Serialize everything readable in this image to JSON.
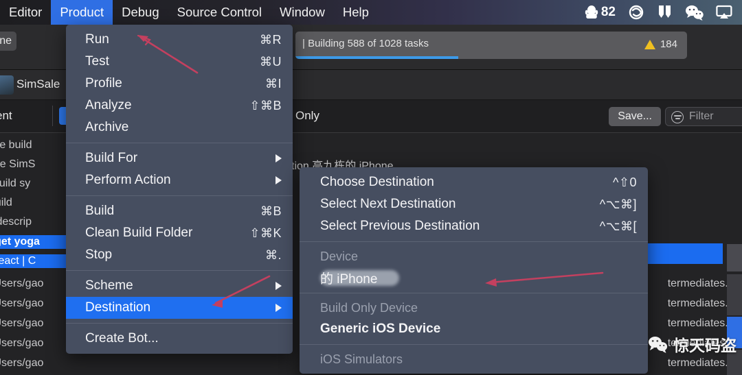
{
  "menubar": {
    "items": [
      {
        "label": "Editor",
        "active": false
      },
      {
        "label": "Product",
        "active": true
      },
      {
        "label": "Debug",
        "active": false
      },
      {
        "label": "Source Control",
        "active": false
      },
      {
        "label": "Window",
        "active": false
      },
      {
        "label": "Help",
        "active": false
      }
    ],
    "status_icons": [
      {
        "name": "qq-icon",
        "badge": "82"
      },
      {
        "name": "adobe-creative-cloud-icon"
      },
      {
        "name": "microsoft-office-icon"
      },
      {
        "name": "wechat-icon"
      },
      {
        "name": "airplay-icon"
      }
    ],
    "qq_count": "82"
  },
  "toolbar": {
    "scheme_pill": "one",
    "status_text": "| Building 588 of 1028 tasks",
    "warning_count": "184",
    "progress_percent": 41.5,
    "project_name": "SimSale",
    "left_label": "ent",
    "only_label": "Only",
    "save_label": "Save...",
    "filter_placeholder": "Filter"
  },
  "product_menu": {
    "groups": [
      [
        {
          "label": "Run",
          "key": "⌘R"
        },
        {
          "label": "Test",
          "key": "⌘U"
        },
        {
          "label": "Profile",
          "key": "⌘I"
        },
        {
          "label": "Analyze",
          "key": "⇧⌘B"
        },
        {
          "label": "Archive",
          "key": ""
        }
      ],
      [
        {
          "label": "Build For",
          "key": "",
          "submenu": true
        },
        {
          "label": "Perform Action",
          "key": "",
          "submenu": true
        }
      ],
      [
        {
          "label": "Build",
          "key": "⌘B"
        },
        {
          "label": "Clean Build Folder",
          "key": "⇧⌘K"
        },
        {
          "label": "Stop",
          "key": "⌘."
        }
      ],
      [
        {
          "label": "Scheme",
          "key": "",
          "submenu": true
        },
        {
          "label": "Destination",
          "key": "",
          "submenu": true,
          "selected": true
        }
      ],
      [
        {
          "label": "Create Bot...",
          "key": ""
        }
      ]
    ]
  },
  "destination_menu": {
    "items": [
      {
        "label": "Choose Destination",
        "key": "^⇧0"
      },
      {
        "label": "Select Next Destination",
        "key": "^⌥⌘]"
      },
      {
        "label": "Select Previous Destination",
        "key": "^⌥⌘["
      }
    ],
    "device_section": "Device",
    "device_name_suffix": "的 iPhone",
    "build_only_section": "Build Only Device",
    "generic_device": "Generic iOS Device",
    "simulators_section": "iOS Simulators"
  },
  "log": {
    "behind_menu_line": "tion 高九栋的 iPhone",
    "left_lines": [
      "re build",
      "pace SimS",
      "w build sy",
      "build",
      "ild descrip"
    ],
    "selected_lines": [
      "arget yoga",
      "t React | C"
    ],
    "path_lines": [
      "/Users/gao",
      "/Users/gao",
      "/Users/gao",
      "/Users/gao",
      "/Users/gao"
    ],
    "right_lines": [
      "termediates.noin",
      "termediates.noin",
      "termediates.noin",
      "termediates.noin",
      "termediates.noin"
    ]
  },
  "annotations": {
    "arrow_color": "#c4405f",
    "arrows": [
      {
        "name": "arrow-to-run"
      },
      {
        "name": "arrow-to-destination"
      },
      {
        "name": "arrow-to-device"
      }
    ]
  },
  "watermark": {
    "text": "惊天码盗",
    "icon": "wechat-icon"
  }
}
